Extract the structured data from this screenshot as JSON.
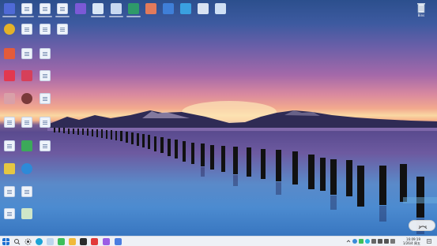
{
  "desktop": {
    "recycle_bin_label": "Bins"
  },
  "taskbar": {
    "pinned_apps": [
      "windows-start",
      "search",
      "task-view",
      "edge",
      "wechat",
      "file-explorer",
      "terminal",
      "wps",
      "notes",
      "browser",
      "extra"
    ],
    "clock_time": "16:09:19",
    "clock_date": "1/26/4 周五"
  },
  "colors": {
    "taskbar_bg": "#eef1f6",
    "sky_top": "#2c4f8d",
    "sunset": "#f9d7a3"
  }
}
